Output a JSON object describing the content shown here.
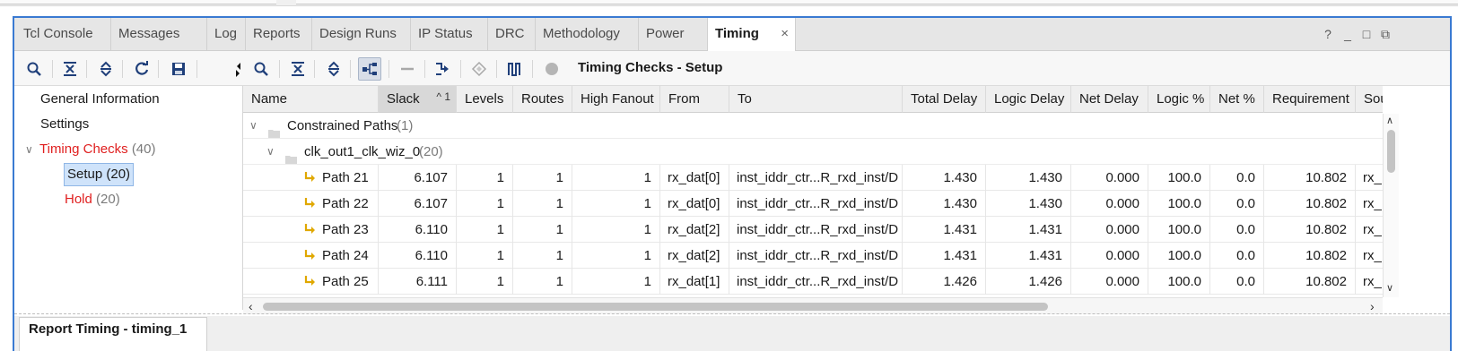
{
  "tabs": [
    {
      "label": "Tcl Console"
    },
    {
      "label": "Messages"
    },
    {
      "label": "Log"
    },
    {
      "label": "Reports"
    },
    {
      "label": "Design Runs"
    },
    {
      "label": "IP Status"
    },
    {
      "label": "DRC"
    },
    {
      "label": "Methodology"
    },
    {
      "label": "Power"
    },
    {
      "label": "Timing",
      "active": true,
      "close": "×"
    }
  ],
  "window_buttons": {
    "help": "?",
    "minimize": "_",
    "maximize": "□",
    "float": "⧉"
  },
  "toolbar": {
    "title": "Timing Checks - Setup",
    "icons": [
      "search-icon",
      "collapse-all-icon",
      "expand-all-icon",
      "refresh-icon",
      "save-icon",
      "scroll-arrows-icon",
      "search-icon",
      "collapse-all-icon",
      "expand-all-icon",
      "hierarchy-icon",
      "minus-icon",
      "schematic-icon",
      "highlight-icon",
      "waveform-icon",
      "mark-icon"
    ]
  },
  "tree": {
    "general": "General Information",
    "settings": "Settings",
    "timing_checks": {
      "label": "Timing Checks",
      "count": "(40)",
      "expander": "∨"
    },
    "setup": "Setup (20)",
    "hold": {
      "label": "Hold",
      "count": "(20)"
    }
  },
  "table": {
    "columns": [
      "Name",
      "Slack",
      "Levels",
      "Routes",
      "High Fanout",
      "From",
      "To",
      "Total Delay",
      "Logic Delay",
      "Net Delay",
      "Logic %",
      "Net %",
      "Requirement",
      "Sou"
    ],
    "sort_indicator": "^ 1",
    "group_constrained": {
      "label": "Constrained Paths",
      "count": "(1)",
      "expander": "∨"
    },
    "group_clock": {
      "label": "clk_out1_clk_wiz_0",
      "count": "(20)",
      "expander": "∨"
    },
    "rows": [
      {
        "name": "Path 21",
        "slack": "6.107",
        "levels": "1",
        "routes": "1",
        "fanout": "1",
        "from": "rx_dat[0]",
        "to": "inst_iddr_ctr...R_rxd_inst/D",
        "total": "1.430",
        "logic": "1.430",
        "net": "0.000",
        "logic_pct": "100.0",
        "net_pct": "0.0",
        "req": "10.802",
        "src": "rx_"
      },
      {
        "name": "Path 22",
        "slack": "6.107",
        "levels": "1",
        "routes": "1",
        "fanout": "1",
        "from": "rx_dat[0]",
        "to": "inst_iddr_ctr...R_rxd_inst/D",
        "total": "1.430",
        "logic": "1.430",
        "net": "0.000",
        "logic_pct": "100.0",
        "net_pct": "0.0",
        "req": "10.802",
        "src": "rx_"
      },
      {
        "name": "Path 23",
        "slack": "6.110",
        "levels": "1",
        "routes": "1",
        "fanout": "1",
        "from": "rx_dat[2]",
        "to": "inst_iddr_ctr...R_rxd_inst/D",
        "total": "1.431",
        "logic": "1.431",
        "net": "0.000",
        "logic_pct": "100.0",
        "net_pct": "0.0",
        "req": "10.802",
        "src": "rx_"
      },
      {
        "name": "Path 24",
        "slack": "6.110",
        "levels": "1",
        "routes": "1",
        "fanout": "1",
        "from": "rx_dat[2]",
        "to": "inst_iddr_ctr...R_rxd_inst/D",
        "total": "1.431",
        "logic": "1.431",
        "net": "0.000",
        "logic_pct": "100.0",
        "net_pct": "0.0",
        "req": "10.802",
        "src": "rx_"
      },
      {
        "name": "Path 25",
        "slack": "6.111",
        "levels": "1",
        "routes": "1",
        "fanout": "1",
        "from": "rx_dat[1]",
        "to": "inst_iddr_ctr...R_rxd_inst/D",
        "total": "1.426",
        "logic": "1.426",
        "net": "0.000",
        "logic_pct": "100.0",
        "net_pct": "0.0",
        "req": "10.802",
        "src": "rx_"
      }
    ]
  },
  "bottom_tab": "Report Timing - timing_1",
  "colors": {
    "accent": "#3a7ad2",
    "path_icon": "#e0a800",
    "red_text": "#e02020"
  }
}
